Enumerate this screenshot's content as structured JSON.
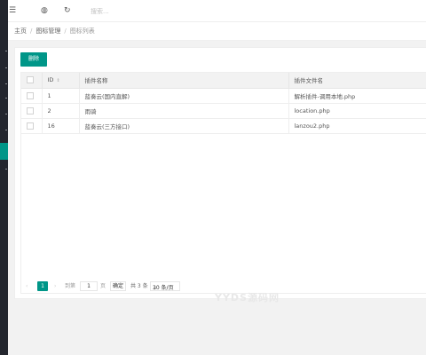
{
  "topbar": {
    "menu_icon": "☰",
    "theme_icon": "◍",
    "refresh_icon": "↻",
    "search_placeholder": "搜索..."
  },
  "breadcrumb": {
    "items": [
      "主页",
      "图标管理",
      "图标列表"
    ]
  },
  "toolbar": {
    "delete_label": "删除"
  },
  "table": {
    "columns": [
      "ID",
      "插件名称",
      "插件文件名"
    ],
    "rows": [
      {
        "id": "1",
        "name": "蓝奏云(国内直解)",
        "file": "解析插件-调用本地.php"
      },
      {
        "id": "2",
        "name": "雨骑",
        "file": "location.php"
      },
      {
        "id": "16",
        "name": "蓝奏云(三方接口)",
        "file": "lanzou2.php"
      }
    ]
  },
  "pagination": {
    "prev": "‹",
    "current": "1",
    "next": "›",
    "goto_label": "到第",
    "page_input": "1",
    "page_label": "页",
    "confirm": "确定",
    "total": "共 3 条",
    "page_size": "30 条/页"
  },
  "watermark": "YYDS源码网",
  "colors": {
    "accent": "#009688",
    "sidebar": "#23262e"
  }
}
